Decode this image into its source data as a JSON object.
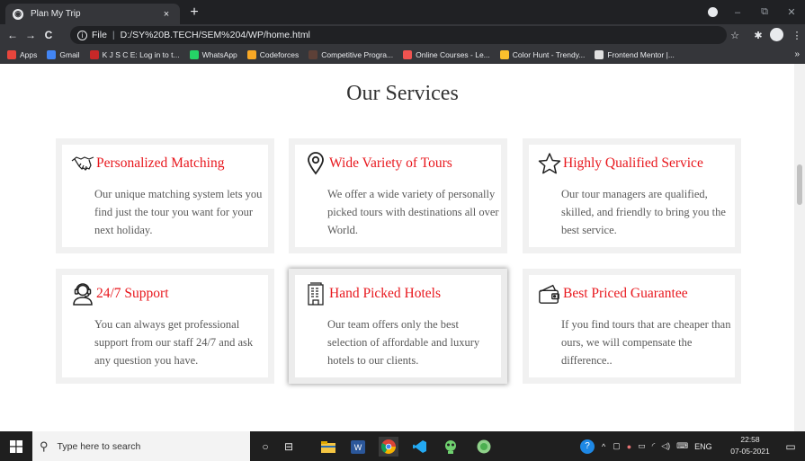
{
  "browser": {
    "tab_title": "Plan My Trip",
    "tab_close": "×",
    "new_tab": "+",
    "url_prefix": "File",
    "url": "D:/SY%20B.TECH/SEM%204/WP/home.html",
    "back": "←",
    "forward": "→",
    "reload": "C",
    "minimize": "–",
    "restore": "⧉",
    "close": "✕",
    "star": "☆",
    "extensions": "✱",
    "menu": "⋮",
    "bookmarks": [
      {
        "label": "Apps",
        "color": "#e8453c"
      },
      {
        "label": "Gmail",
        "color": "#4285f4"
      },
      {
        "label": "K J S C E: Log in to t...",
        "color": "#c62828"
      },
      {
        "label": "WhatsApp",
        "color": "#25d366"
      },
      {
        "label": "Codeforces",
        "color": "#f9a825"
      },
      {
        "label": "Competitive Progra...",
        "color": "#5d4037"
      },
      {
        "label": "Online Courses - Le...",
        "color": "#ef5350"
      },
      {
        "label": "Color Hunt - Trendy...",
        "color": "#fbc02d"
      },
      {
        "label": "Frontend Mentor |...",
        "color": "#e0e0e0"
      }
    ],
    "bookmarks_more": "»"
  },
  "page": {
    "heading": "Our Services",
    "accent_color": "#e8171d",
    "services": [
      {
        "title": "Personalized Matching",
        "icon": "handshake-icon",
        "description": "Our unique matching system lets you find just the tour you want for your next holiday."
      },
      {
        "title": "Wide Variety of Tours",
        "icon": "location-pin-icon",
        "description": "We offer a wide variety of personally picked tours with destinations all over World."
      },
      {
        "title": "Highly Qualified Service",
        "icon": "star-icon",
        "description": "Our tour managers are qualified, skilled, and friendly to bring you the best service."
      },
      {
        "title": "24/7 Support",
        "icon": "support-agent-icon",
        "description": "You can always get professional support from our staff 24/7 and ask any question you have."
      },
      {
        "title": "Hand Picked Hotels",
        "icon": "hotel-icon",
        "description": "Our team offers only the best selection of affordable and luxury hotels to our clients."
      },
      {
        "title": "Best Priced Guarantee",
        "icon": "wallet-icon",
        "description": "If you find tours that are cheaper than ours, we will compensate the difference.."
      }
    ]
  },
  "taskbar": {
    "search_placeholder": "Type here to search",
    "language": "ENG",
    "time": "22:58",
    "date": "07-05-2021"
  }
}
